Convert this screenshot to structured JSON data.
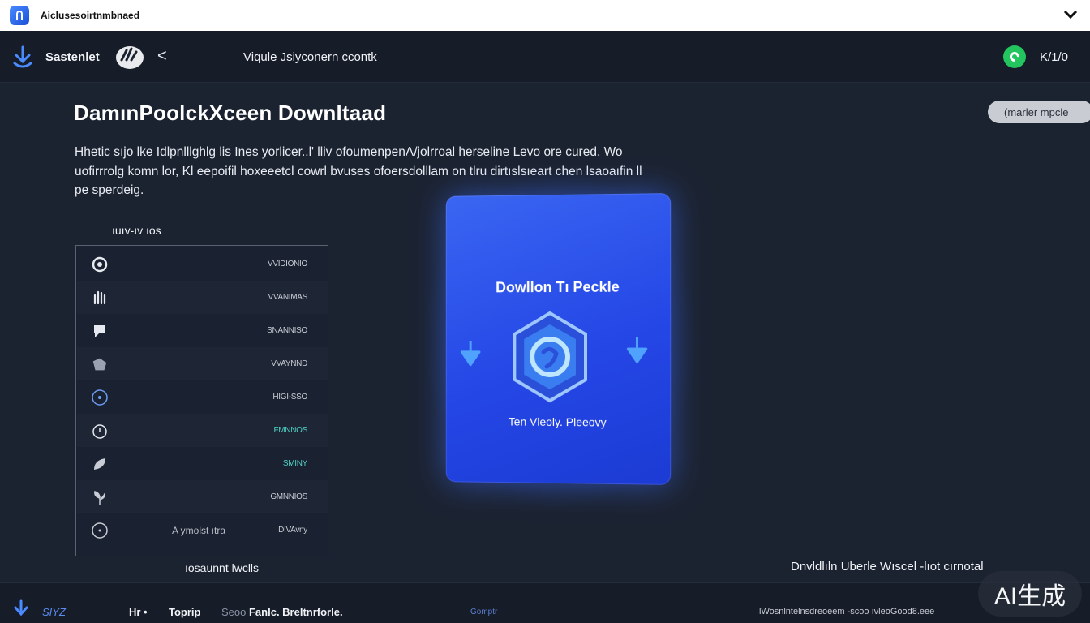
{
  "titlebar": {
    "title": "Aiclusesoirtnmbnaed"
  },
  "nav": {
    "brand": "Sastenlet",
    "back": "<",
    "center_title": "Viqule Jsiyconern ccontk",
    "count": "K/1/0"
  },
  "main": {
    "title": "DamınPoolckXceen Downltaad",
    "pill_label": "(marler mpcle",
    "description": "Hhetic sıjo lke Idlpnlllghlg lis Ines yorlicer..l' lliv ofoumenpenΛ/jolrroal herseline Levo ore cured. Wo uofirrrolg komn lor, Kl eepoifil hoxeeetcl cowrl bvuses ofoersdolllam on tlru dirtıslsıeart chen lsaoaıfin ll pe sperdeig."
  },
  "list": {
    "title": "ıuıv-ıv ıos",
    "rows": [
      {
        "icon": "eye-icon",
        "value": "VVIDIONIO"
      },
      {
        "icon": "hand-icon",
        "value": "VVANIMAS"
      },
      {
        "icon": "chat-icon",
        "value": "SNANNISO"
      },
      {
        "icon": "puzzle-icon",
        "value": "VVAYNND"
      },
      {
        "icon": "dot-circle-icon",
        "value": "HIGI-SSO"
      },
      {
        "icon": "timer-icon",
        "value": "FMNNOS"
      },
      {
        "icon": "leaf-icon",
        "value": "SMINY"
      },
      {
        "icon": "plant-icon",
        "value": "GMNNIOS"
      },
      {
        "icon": "dot-circle-icon",
        "mid": "A ymolst ıtra",
        "value": "DIVAvny"
      }
    ],
    "footer": "ıosaunnt lwclls"
  },
  "card": {
    "title": "Dowllon Tı Peckle",
    "subtitle": "Ten Vleoly. Pleeovy"
  },
  "bottom_right": "Dnvldlıln Uberle  Wıscel -lıot cırnotal",
  "footer": {
    "item1": "SIYZ",
    "item2": "Hr •",
    "item3": "Toprip",
    "item4_muted": "Seoo ",
    "item4": "Fanlc. Breltnrforle.",
    "item5": "Gomptr",
    "item6": "lWosnlntelnsdreoeem -scoo ıvleoGood8.eee"
  },
  "watermark": "AI生成",
  "colors": {
    "accent_blue": "#2547e6",
    "status_green": "#22c55e",
    "background": "#1b2230",
    "teal": "#4fd1c5"
  }
}
